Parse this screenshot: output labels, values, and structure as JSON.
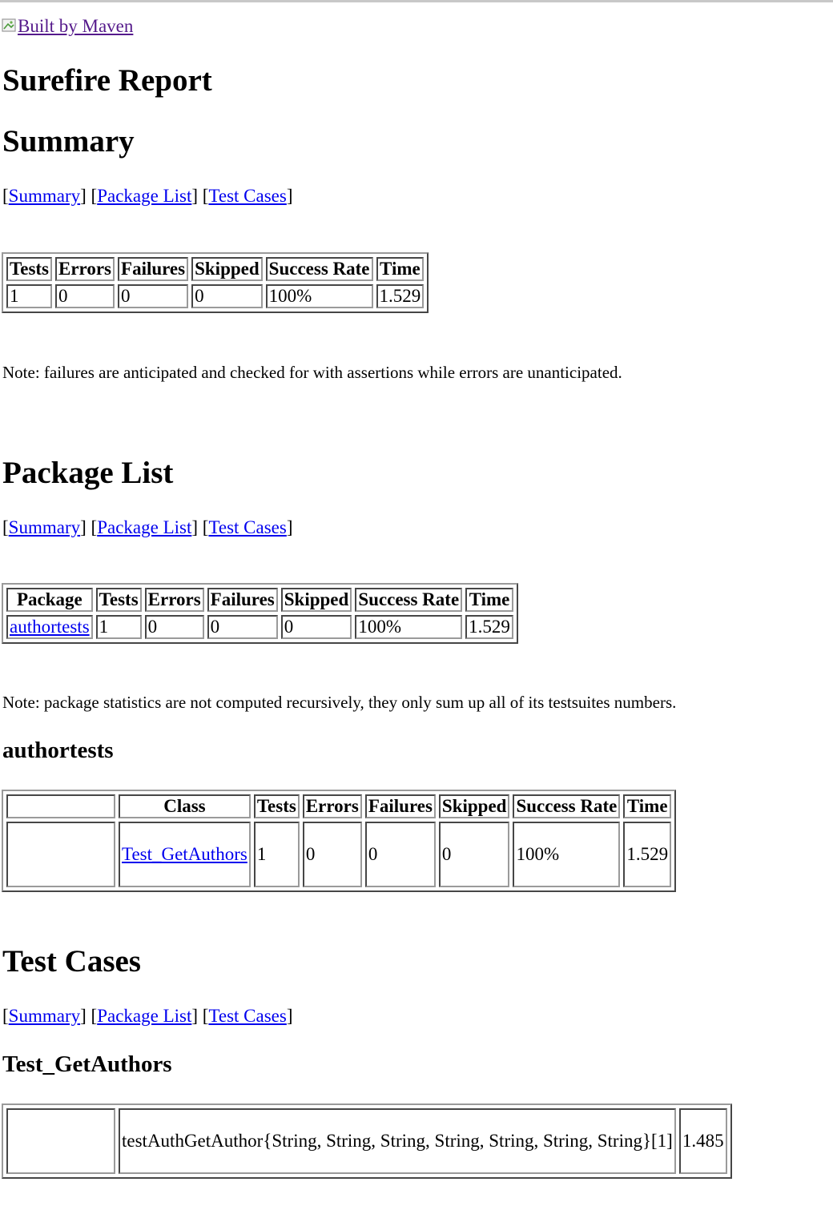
{
  "header": {
    "maven_badge_alt": "Built by Maven",
    "page_title": "Surefire Report"
  },
  "nav": {
    "summary": "Summary",
    "package_list": "Package List",
    "test_cases": "Test Cases"
  },
  "summary": {
    "heading": "Summary",
    "columns": [
      "Tests",
      "Errors",
      "Failures",
      "Skipped",
      "Success Rate",
      "Time"
    ],
    "row": [
      "1",
      "0",
      "0",
      "0",
      "100%",
      "1.529"
    ],
    "note": "Note: failures are anticipated and checked for with assertions while errors are unanticipated."
  },
  "package_list": {
    "heading": "Package List",
    "columns": [
      "Package",
      "Tests",
      "Errors",
      "Failures",
      "Skipped",
      "Success Rate",
      "Time"
    ],
    "row": [
      "authortests",
      "1",
      "0",
      "0",
      "0",
      "100%",
      "1.529"
    ],
    "note": "Note: package statistics are not computed recursively, they only sum up all of its testsuites numbers."
  },
  "package_detail": {
    "heading": "authortests",
    "columns": [
      "",
      "Class",
      "Tests",
      "Errors",
      "Failures",
      "Skipped",
      "Success Rate",
      "Time"
    ],
    "row": [
      "",
      "Test_GetAuthors",
      "1",
      "0",
      "0",
      "0",
      "100%",
      "1.529"
    ]
  },
  "test_cases": {
    "heading": "Test Cases",
    "class_heading": "Test_GetAuthors",
    "row": [
      "",
      "testAuthGetAuthor{String, String, String, String, String, String, String}[1]",
      "1.485"
    ]
  }
}
